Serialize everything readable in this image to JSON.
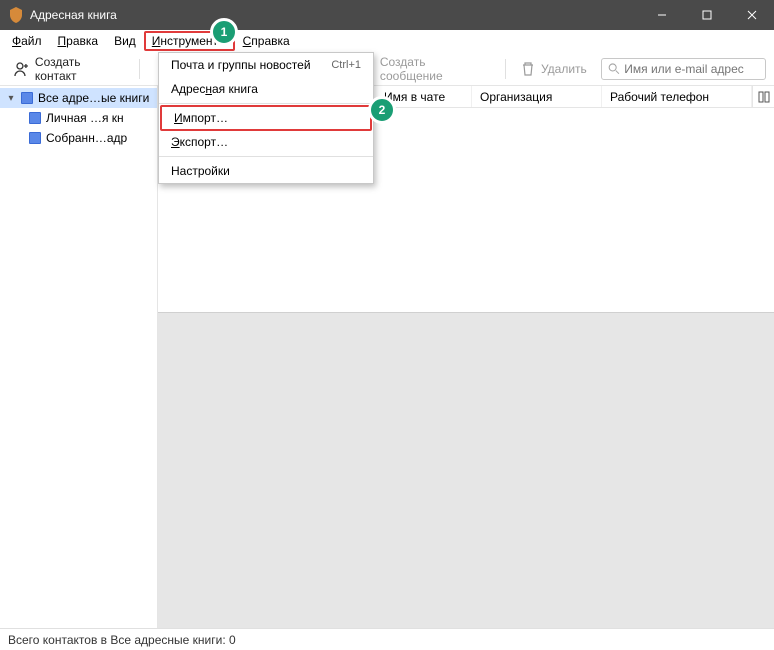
{
  "titlebar": {
    "title": "Адресная книга"
  },
  "menubar": {
    "file": "Файл",
    "edit": "Правка",
    "view": "Вид",
    "tools": "Инструменты",
    "help": "Справка"
  },
  "toolbar": {
    "new_contact": "Создать контакт",
    "compose_msg": "Создать сообщение",
    "delete": "Удалить",
    "search_placeholder": "Имя или e-mail адрес"
  },
  "sidebar": {
    "root": "Все адре…ые книги",
    "children": [
      {
        "label": "Личная …я кн"
      },
      {
        "label": "Собранн…адр"
      }
    ]
  },
  "columns": {
    "name_chat": "Имя в чате",
    "org": "Организация",
    "work_phone": "Рабочий телефон"
  },
  "dropdown": {
    "mail_groups": {
      "label": "Почта и группы новостей",
      "shortcut": "Ctrl+1"
    },
    "addr_book": "Адресная книга",
    "import": "Импорт…",
    "export": "Экспорт…",
    "settings": "Настройки"
  },
  "badges": {
    "one": "1",
    "two": "2"
  },
  "status": "Всего контактов в Все адресные книги: 0"
}
